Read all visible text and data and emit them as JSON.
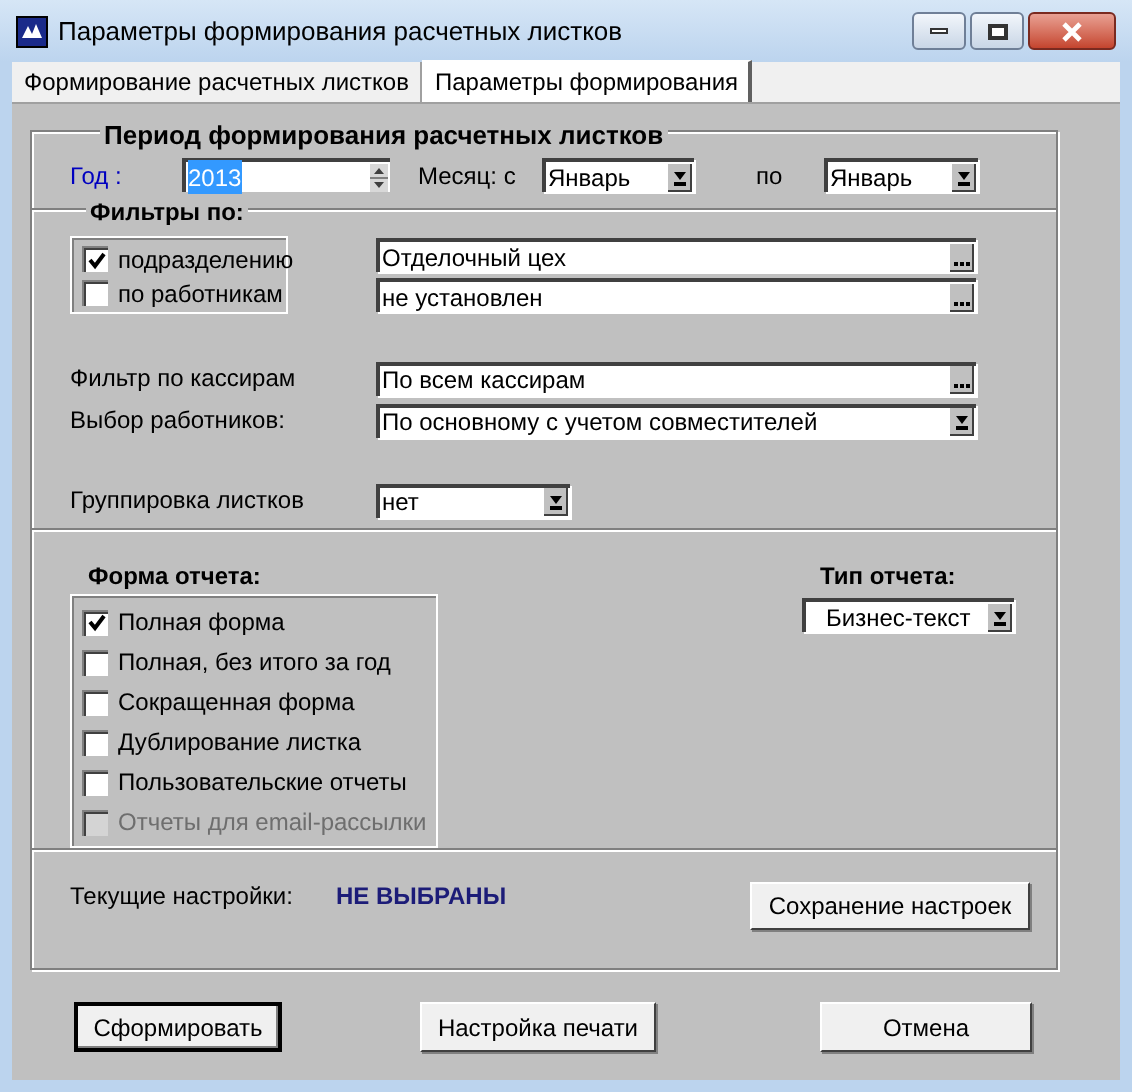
{
  "window": {
    "title": "Параметры формирования расчетных листков"
  },
  "tabs": [
    {
      "label": "Формирование расчетных листков",
      "selected": false
    },
    {
      "label": "Параметры формирования",
      "selected": true
    }
  ],
  "period": {
    "title": "Период формирования расчетных листков",
    "year_label": "Год :",
    "year_value": "2013",
    "year_highlighted": true,
    "month_from_label": "Месяц: с",
    "month_from": "Январь",
    "month_to_label": "по",
    "month_to": "Январь"
  },
  "filters": {
    "title": "Фильтры по:",
    "options": [
      {
        "label": "подразделению",
        "checked": true,
        "value": "Отделочный цех"
      },
      {
        "label": "по работникам",
        "checked": false,
        "value": "не установлен"
      }
    ]
  },
  "cashier_filter": {
    "label": "Фильтр по кассирам",
    "value": "По всем кассирам"
  },
  "employee_selection": {
    "label": "Выбор работников:",
    "value": "По основному с учетом совместителей"
  },
  "grouping": {
    "label": "Группировка листков",
    "value": "нет"
  },
  "report_form": {
    "title": "Форма отчета:",
    "options": [
      {
        "label": "Полная форма",
        "checked": true,
        "disabled": false
      },
      {
        "label": "Полная, без итого за год",
        "checked": false,
        "disabled": false
      },
      {
        "label": "Сокращенная форма",
        "checked": false,
        "disabled": false
      },
      {
        "label": "Дублирование листка",
        "checked": false,
        "disabled": false
      },
      {
        "label": "Пользовательские отчеты",
        "checked": false,
        "disabled": false
      },
      {
        "label": "Отчеты для email-рассылки",
        "checked": false,
        "disabled": true
      }
    ]
  },
  "report_type": {
    "label": "Тип отчета:",
    "value": "Бизнес-текст"
  },
  "current_settings": {
    "label": "Текущие настройки:",
    "value": "НЕ ВЫБРАНЫ"
  },
  "save_settings_button": "Сохранение настроек",
  "buttons": [
    {
      "label": "Сформировать",
      "default": true
    },
    {
      "label": "Настройка печати",
      "default": false
    },
    {
      "label": "Отмена",
      "default": false
    }
  ]
}
